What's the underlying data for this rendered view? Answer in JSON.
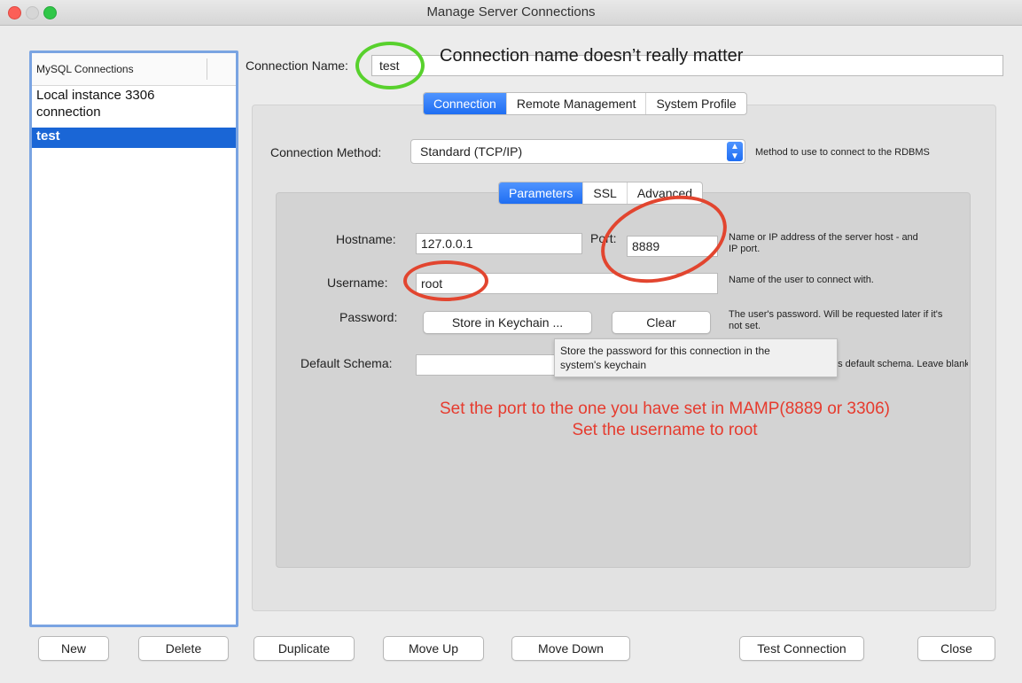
{
  "window": {
    "title": "Manage Server Connections"
  },
  "sidebar": {
    "header": "MySQL Connections",
    "items": [
      "Local instance 3306\nconnection",
      "test"
    ]
  },
  "connection_name": {
    "label": "Connection Name:",
    "value": "test"
  },
  "main_tabs": [
    "Connection",
    "Remote Management",
    "System Profile"
  ],
  "connection_method": {
    "label": "Connection Method:",
    "value": "Standard (TCP/IP)",
    "help": "Method to use to connect to the RDBMS"
  },
  "param_tabs": [
    "Parameters",
    "SSL",
    "Advanced"
  ],
  "hostname": {
    "label": "Hostname:",
    "value": "127.0.0.1",
    "help": "Name or IP address of the server host - and\nIP port."
  },
  "port": {
    "label": "Port:",
    "value": "8889"
  },
  "username": {
    "label": "Username:",
    "value": "root",
    "help": "Name of the user to connect with."
  },
  "password": {
    "label": "Password:",
    "store_button": "Store in Keychain ...",
    "clear_button": "Clear",
    "help": "The user's password. Will be requested later if it's\nnot set.",
    "tooltip": "Store the password for this connection in the\nsystem's keychain"
  },
  "default_schema": {
    "label": "Default Schema:",
    "value": "",
    "help": "as default schema. Leave blank"
  },
  "annotations": {
    "name_note": "Connection name doesn’t really matter",
    "port_note": "Set the port to the one you have set in MAMP(8889 or 3306)",
    "user_note": "Set the username to root"
  },
  "buttons": {
    "new": "New",
    "delete": "Delete",
    "duplicate": "Duplicate",
    "move_up": "Move Up",
    "move_down": "Move Down",
    "test_connection": "Test Connection",
    "close": "Close"
  },
  "colors": {
    "accent": "#1f6ef2",
    "annotation_red": "#e2452f",
    "annotation_green": "#58d12d"
  }
}
